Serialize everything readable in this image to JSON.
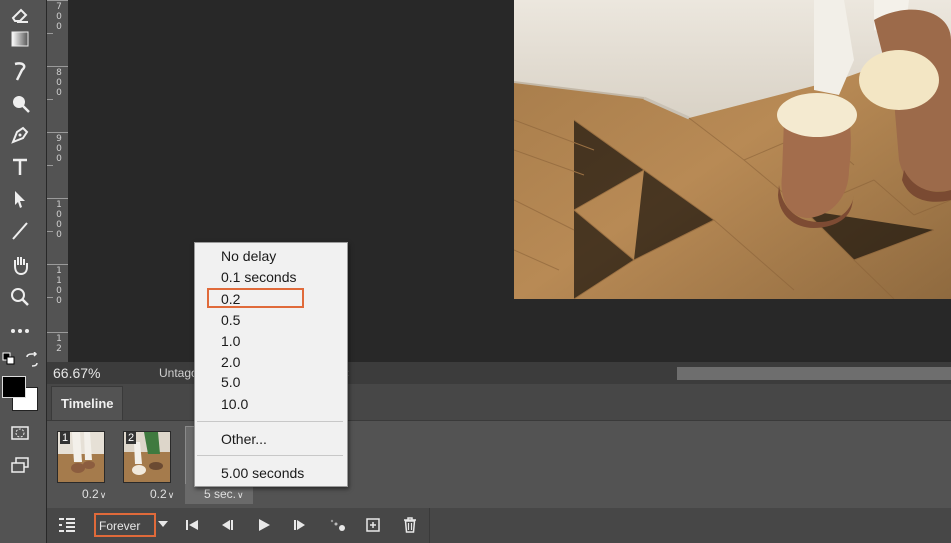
{
  "status": {
    "zoom": "66.67%",
    "document_name": "Untago"
  },
  "ruler": {
    "labels": [
      "7 0 0",
      "8 0 0",
      "9 0 0",
      "1 0 0 0",
      "1 1 0 0",
      "1 2"
    ]
  },
  "timeline": {
    "tab_label": "Timeline",
    "frames": [
      {
        "number": "1",
        "delay": "0.2"
      },
      {
        "number": "2",
        "delay": "0.2"
      },
      {
        "number": "",
        "delay": "5 sec."
      }
    ],
    "loop_option": "Forever"
  },
  "delay_menu": {
    "items": [
      "No delay",
      "0.1 seconds",
      "0.2",
      "0.5",
      "1.0",
      "2.0",
      "5.0",
      "10.0"
    ],
    "other": "Other...",
    "current": "5.00 seconds",
    "highlighted": "0.2",
    "highlight_color": "#e06a3a"
  },
  "colors": {
    "foreground": "#000000",
    "background": "#ffffff",
    "accent": "#e06a3a"
  }
}
